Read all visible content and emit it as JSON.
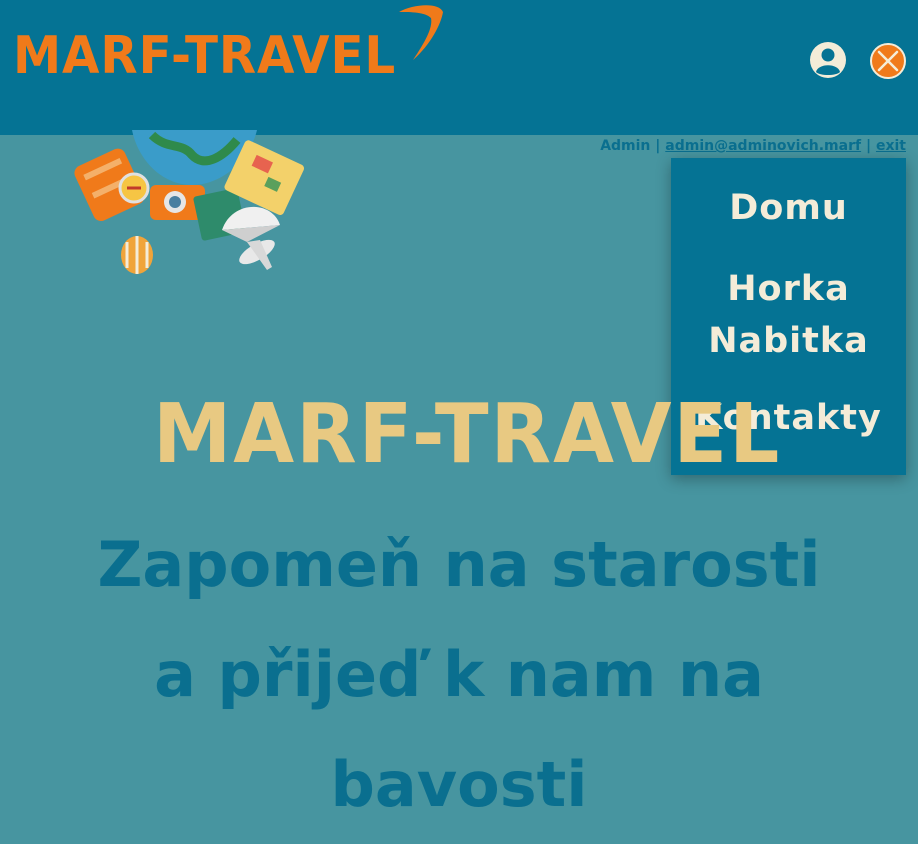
{
  "header": {
    "logo_text": "MARF-TRAVEL",
    "colors": {
      "bg": "#057394",
      "logo": "#f07a1a"
    },
    "icons": {
      "user": "user-circle-icon",
      "close": "close-circle-icon"
    }
  },
  "admin_bar": {
    "name": "Admin",
    "separator": "|",
    "email": "admin@adminovich.marf",
    "exit": "exit"
  },
  "menu": {
    "items": [
      {
        "label": "Domu"
      },
      {
        "label": "Horka Nabitka"
      },
      {
        "label": "Kontakty"
      }
    ]
  },
  "hero": {
    "title": "MARF-TRAVEL",
    "tagline_lines": [
      "Zapomeň na starosti",
      "a přijeď k nam na",
      "bavosti"
    ],
    "image_icon": "travel-globe-icon",
    "colors": {
      "title": "#e8c982",
      "tagline": "#0a6f8f",
      "bg": "#4795a0"
    }
  }
}
